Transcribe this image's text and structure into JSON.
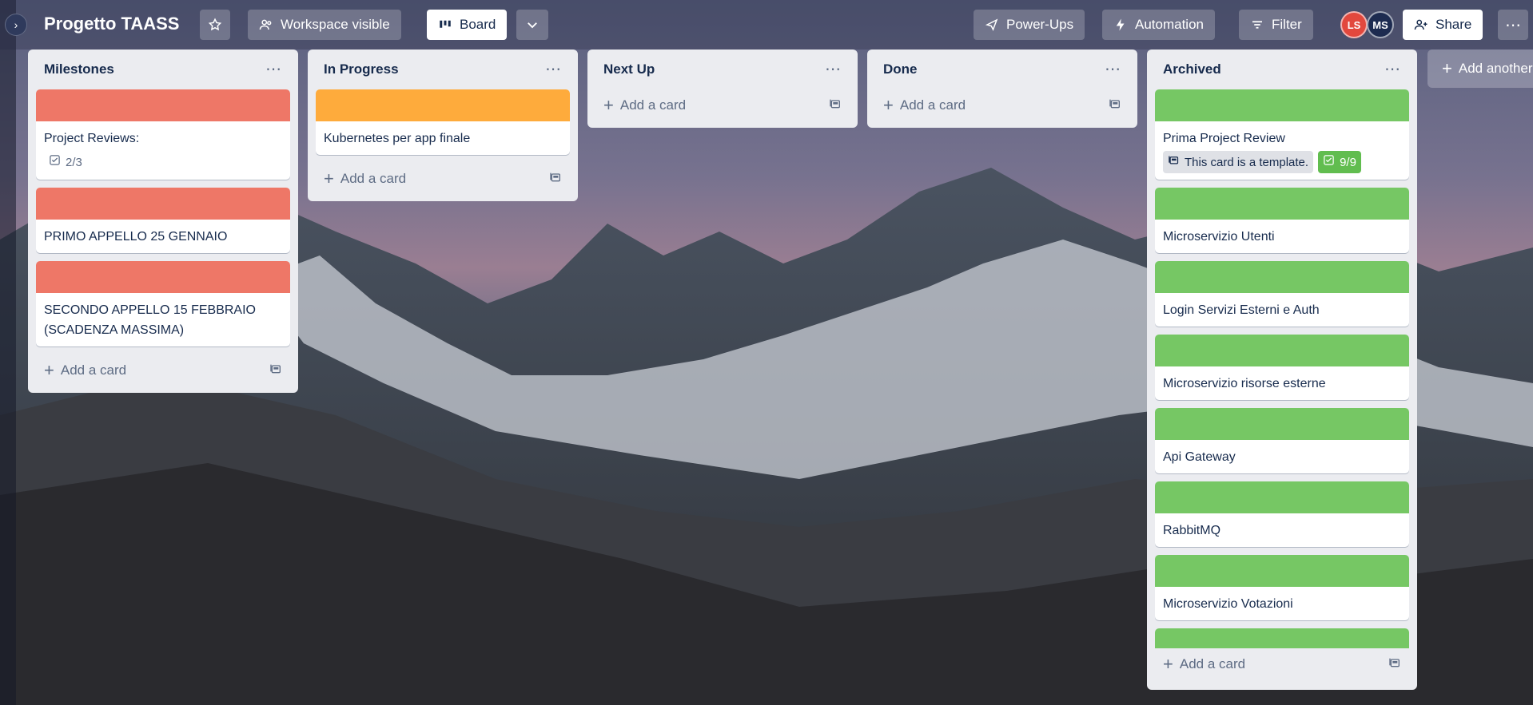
{
  "board": {
    "title": "Progetto TAASS",
    "visibility_label": "Workspace visible",
    "view_label": "Board"
  },
  "header": {
    "powerups_label": "Power-Ups",
    "automation_label": "Automation",
    "filter_label": "Filter",
    "share_label": "Share",
    "avatars": [
      {
        "initials": "LS",
        "color": "#e2483d"
      },
      {
        "initials": "MS",
        "color": "#1d2b50"
      }
    ]
  },
  "colors": {
    "cover_red": "#ee7767",
    "cover_orange": "#feab3c",
    "cover_green": "#76c764"
  },
  "lists": [
    {
      "title": "Milestones",
      "add_card_label": "Add a card",
      "cards": [
        {
          "title": "Project Reviews:",
          "cover": "red",
          "checklist": "2/3"
        },
        {
          "title": "PRIMO APPELLO 25 GENNAIO",
          "cover": "red"
        },
        {
          "title": "SECONDO APPELLO 15 FEBBRAIO (SCADENZA MASSIMA)",
          "cover": "red"
        }
      ]
    },
    {
      "title": "In Progress",
      "add_card_label": "Add a card",
      "cards": [
        {
          "title": "Kubernetes per app finale",
          "cover": "orange"
        }
      ]
    },
    {
      "title": "Next Up",
      "add_card_label": "Add a card",
      "cards": []
    },
    {
      "title": "Done",
      "add_card_label": "Add a card",
      "cards": []
    },
    {
      "title": "Archived",
      "add_card_label": "Add a card",
      "cards": [
        {
          "title": "Prima Project Review",
          "cover": "green",
          "template_badge": "This card is a template.",
          "checklist": "9/9"
        },
        {
          "title": "Microservizio Utenti",
          "cover": "green"
        },
        {
          "title": "Login Servizi Esterni e Auth",
          "cover": "green"
        },
        {
          "title": "Microservizio risorse esterne",
          "cover": "green"
        },
        {
          "title": "Api Gateway",
          "cover": "green"
        },
        {
          "title": "RabbitMQ",
          "cover": "green"
        },
        {
          "title": "Microservizio Votazioni",
          "cover": "green"
        },
        {
          "title": "",
          "cover": "green"
        }
      ]
    }
  ],
  "add_list_label": "Add another list"
}
